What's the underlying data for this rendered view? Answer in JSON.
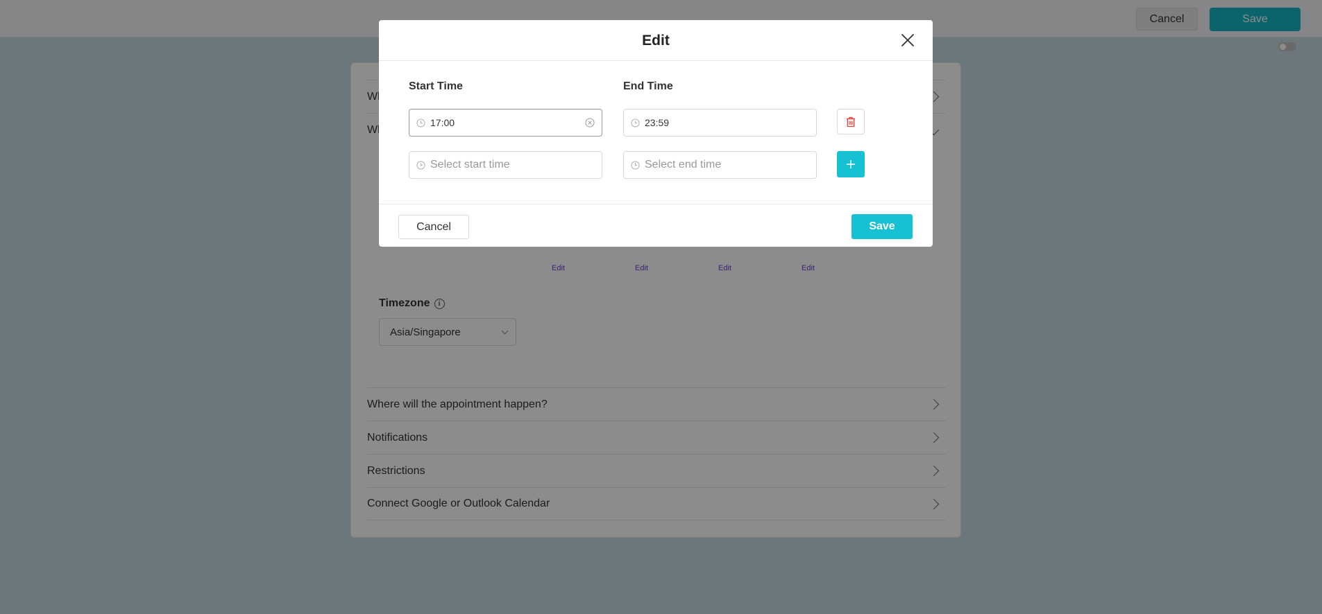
{
  "topbar": {
    "cancel_label": "Cancel",
    "save_label": "Save"
  },
  "background": {
    "collapsed_row_1": "Wh",
    "collapsed_row_2": "Wh",
    "edit_links": [
      "Edit",
      "Edit",
      "Edit",
      "Edit"
    ],
    "timezone": {
      "label": "Timezone",
      "value": "Asia/Singapore"
    },
    "sections": [
      "Where will the appointment happen?",
      "Notifications",
      "Restrictions",
      "Connect Google or Outlook Calendar"
    ]
  },
  "modal": {
    "title": "Edit",
    "start_label": "Start Time",
    "end_label": "End Time",
    "rows": [
      {
        "start": "17:00",
        "end": "23:59"
      }
    ],
    "start_placeholder": "Select start time",
    "end_placeholder": "Select end time",
    "cancel_label": "Cancel",
    "save_label": "Save"
  },
  "colors": {
    "accent": "#17c1d4",
    "delete": "#e53935",
    "link": "#6b3fd6"
  }
}
